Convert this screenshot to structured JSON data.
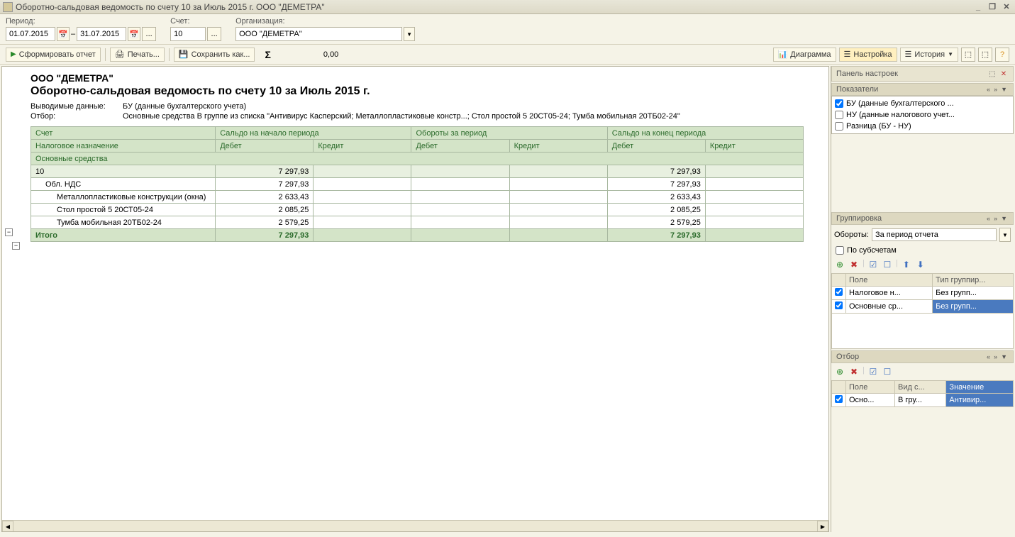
{
  "window": {
    "title": "Оборотно-сальдовая ведомость по счету 10 за Июль 2015 г. ООО \"ДЕМЕТРА\""
  },
  "params": {
    "period_label": "Период:",
    "date_from": "01.07.2015",
    "date_to": "31.07.2015",
    "account_label": "Счет:",
    "account": "10",
    "org_label": "Организация:",
    "org": "ООО \"ДЕМЕТРА\""
  },
  "toolbar": {
    "form_report": "Сформировать отчет",
    "print": "Печать...",
    "save_as": "Сохранить как...",
    "sum_value": "0,00",
    "diagram": "Диаграмма",
    "settings": "Настройка",
    "history": "История"
  },
  "report": {
    "org_name": "ООО \"ДЕМЕТРА\"",
    "title": "Оборотно-сальдовая ведомость по счету 10 за Июль 2015 г.",
    "output_label": "Выводимые данные:",
    "output_value": "БУ (данные бухгалтерского учета)",
    "filter_label": "Отбор:",
    "filter_value": "Основные средства В группе из списка \"Антивирус Касперский; Металлопластиковые констр...; Стол простой 5 20СТ05-24; Тумба мобильная 20ТБ02-24\"",
    "headers": {
      "account": "Счет",
      "balance_start": "Сальдо на начало периода",
      "turnover": "Обороты за период",
      "balance_end": "Сальдо на конец периода",
      "tax_purpose": "Налоговое назначение",
      "debit": "Дебет",
      "credit": "Кредит",
      "main_assets": "Основные средства"
    },
    "rows": [
      {
        "label": "10",
        "class": "acc-row",
        "indent": 0,
        "d1": "7 297,93",
        "c1": "",
        "d2": "",
        "c2": "",
        "d3": "7 297,93",
        "c3": ""
      },
      {
        "label": "Обл. НДС",
        "class": "",
        "indent": 1,
        "d1": "7 297,93",
        "c1": "",
        "d2": "",
        "c2": "",
        "d3": "7 297,93",
        "c3": ""
      },
      {
        "label": "Металлопластиковые конструкции (окна)",
        "class": "",
        "indent": 2,
        "d1": "2 633,43",
        "c1": "",
        "d2": "",
        "c2": "",
        "d3": "2 633,43",
        "c3": ""
      },
      {
        "label": "Стол простой 5 20СТ05-24",
        "class": "",
        "indent": 2,
        "d1": "2 085,25",
        "c1": "",
        "d2": "",
        "c2": "",
        "d3": "2 085,25",
        "c3": ""
      },
      {
        "label": "Тумба мобильная 20ТБ02-24",
        "class": "",
        "indent": 2,
        "d1": "2 579,25",
        "c1": "",
        "d2": "",
        "c2": "",
        "d3": "2 579,25",
        "c3": ""
      }
    ],
    "total": {
      "label": "Итого",
      "d1": "7 297,93",
      "c1": "",
      "d2": "",
      "c2": "",
      "d3": "7 297,93",
      "c3": ""
    }
  },
  "settings": {
    "panel_title": "Панель настроек",
    "indicators": {
      "title": "Показатели",
      "items": [
        {
          "label": "БУ (данные бухгалтерского ...",
          "checked": true
        },
        {
          "label": "НУ (данные налогового учет...",
          "checked": false
        },
        {
          "label": "Разница (БУ - НУ)",
          "checked": false
        }
      ]
    },
    "grouping": {
      "title": "Группировка",
      "turnover_label": "Обороты:",
      "turnover_value": "За период отчета",
      "by_subaccounts": "По субсчетам",
      "col_field": "Поле",
      "col_type": "Тип группир...",
      "rows": [
        {
          "field": "Налоговое н...",
          "type": "Без групп...",
          "checked": true,
          "sel": false
        },
        {
          "field": "Основные ср...",
          "type": "Без групп...",
          "checked": true,
          "sel": true
        }
      ]
    },
    "filter": {
      "title": "Отбор",
      "col_field": "Поле",
      "col_cond": "Вид с...",
      "col_value": "Значение",
      "rows": [
        {
          "field": "Осно...",
          "cond": "В гру...",
          "value": "Антивир...",
          "checked": true
        }
      ]
    }
  }
}
